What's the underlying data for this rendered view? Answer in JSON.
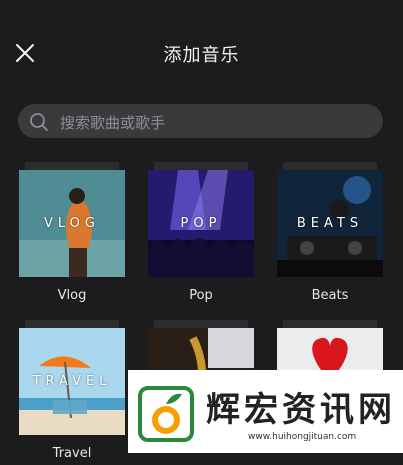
{
  "header": {
    "title": "添加音乐",
    "close_icon": "close-icon"
  },
  "search": {
    "placeholder": "搜索歌曲或歌手",
    "icon": "search-icon"
  },
  "categories": [
    {
      "caption": "Vlog",
      "thumb_label": "VLOG"
    },
    {
      "caption": "Pop",
      "thumb_label": "POP"
    },
    {
      "caption": "Beats",
      "thumb_label": "BEATS"
    },
    {
      "caption": "Travel",
      "thumb_label": "TRAVEL"
    },
    {
      "caption": "",
      "thumb_label": ""
    },
    {
      "caption": "",
      "thumb_label": ""
    }
  ],
  "watermark": {
    "text": "辉宏资讯网",
    "url": "www.huihongjituan.com"
  },
  "colors": {
    "background": "#1c1c1e",
    "search_bg": "#3a3a3c",
    "placeholder": "#8e8e93"
  }
}
